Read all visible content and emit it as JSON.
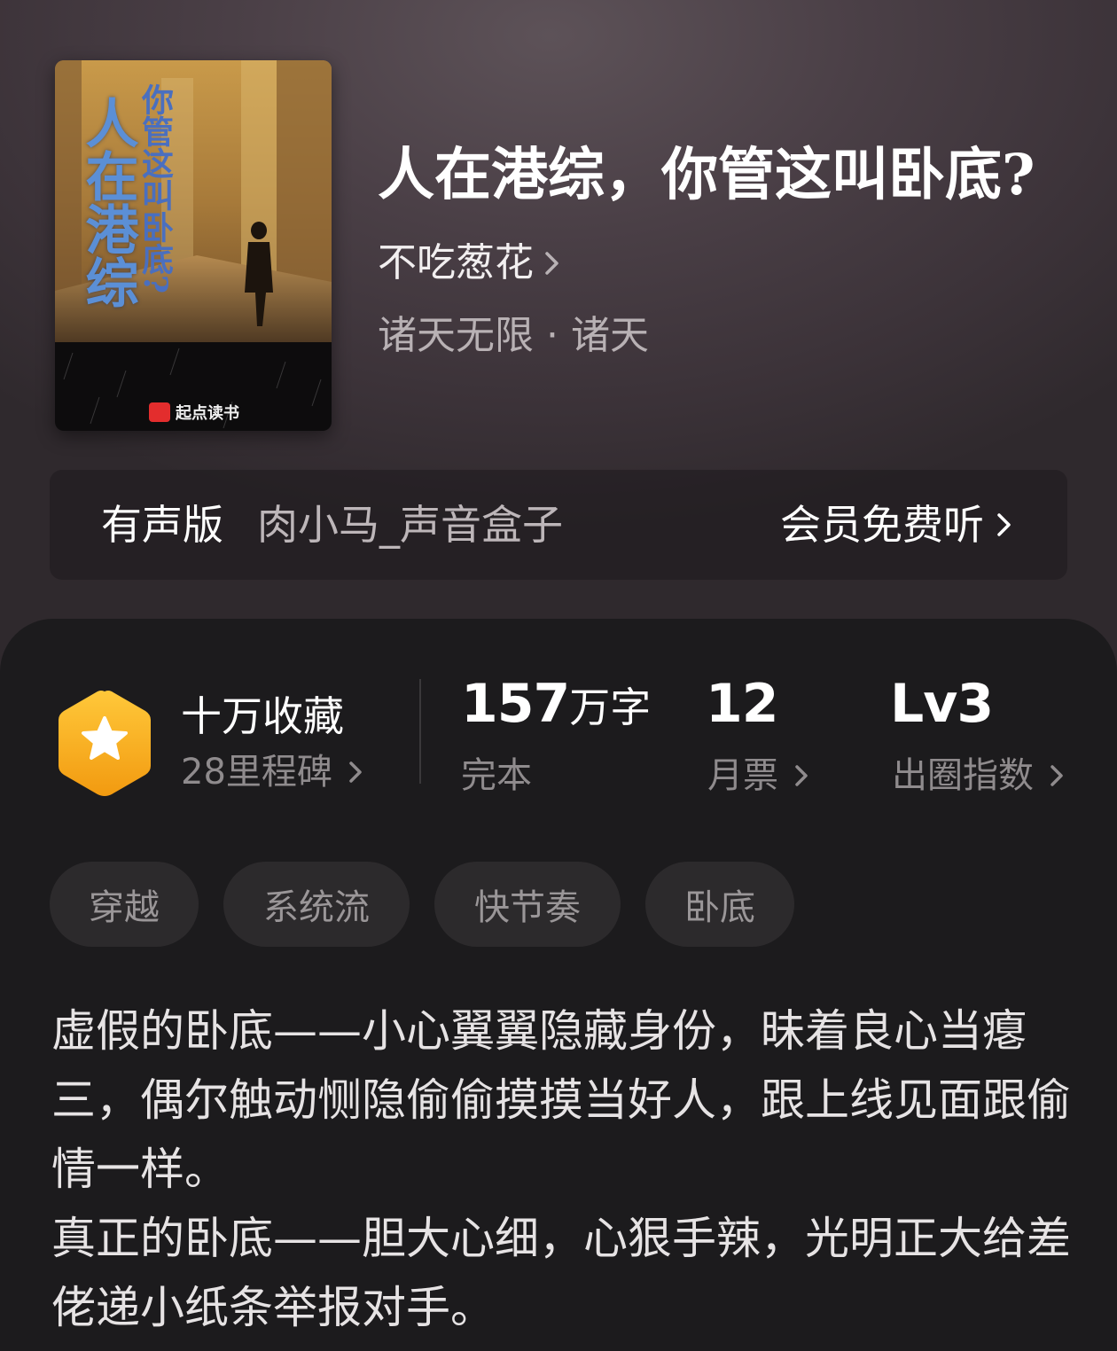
{
  "book": {
    "title": "人在港综，你管这叫卧底?",
    "author": "不吃葱花",
    "genre": "诸天无限 · 诸天",
    "cover": {
      "title_main": "人在港综",
      "title_sub": "你管这叫卧底?",
      "brand": "起点读书"
    }
  },
  "audio": {
    "label": "有声版",
    "narrator": "肉小马_声音盒子",
    "cta": "会员免费听"
  },
  "stats": {
    "collection": {
      "title": "十万收藏",
      "sub": "28里程碑"
    },
    "words": {
      "number": "157",
      "unit": "万字",
      "sub": "完本"
    },
    "tickets": {
      "number": "12",
      "sub": "月票"
    },
    "index": {
      "number": "Lv3",
      "sub": "出圈指数"
    }
  },
  "tags": [
    "穿越",
    "系统流",
    "快节奏",
    "卧底"
  ],
  "description": [
    "虚假的卧底——小心翼翼隐藏身份，昧着良心当瘪三，偶尔触动恻隐偷偷摸摸当好人，跟上线见面跟偷情一样。",
    "真正的卧底——胆大心细，心狠手辣，光明正大给差佬递小纸条举报对手。"
  ],
  "colors": {
    "accent_star": "#f7b21a",
    "muted_text": "#8f8b8d",
    "tag_bg": "#2c2a2c",
    "panel_bg": "#1c1b1d"
  }
}
